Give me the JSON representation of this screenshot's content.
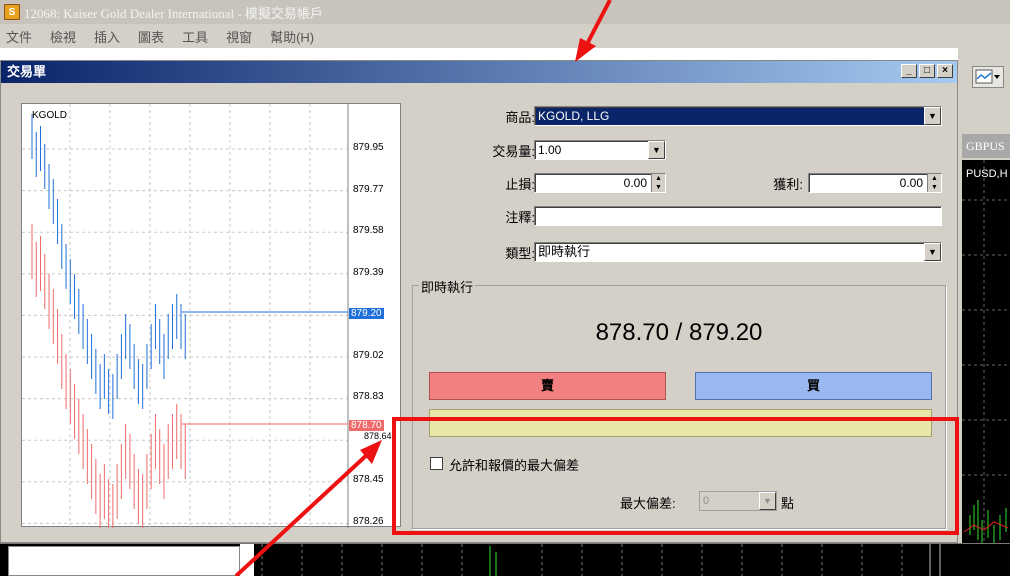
{
  "app": {
    "title": "12068: Kaiser Gold Dealer International - 模擬交易帳戶",
    "icon": "mt4-logo-icon"
  },
  "menu": [
    "文件",
    "檢視",
    "插入",
    "圖表",
    "工具",
    "視窗",
    "幫助(H)"
  ],
  "side": {
    "tab_label": "GBPUS",
    "chart_label": "PUSD,H"
  },
  "dialog": {
    "title": "交易單",
    "window_buttons": [
      "_",
      "□",
      "×"
    ],
    "chart": {
      "symbol": "KGOLD",
      "price_ticks": [
        "879.95",
        "879.77",
        "879.58",
        "879.39",
        "879.02",
        "878.83",
        "878.45",
        "878.26"
      ],
      "ask_tag": "879.20",
      "bid_tag": "878.70",
      "bid_tag_partial": "878.64"
    },
    "form": {
      "symbol_label": "商品:",
      "symbol_value": "KGOLD, LLG",
      "volume_label": "交易量:",
      "volume_value": "1.00",
      "stoploss_label": "止損:",
      "stoploss_value": "0.00",
      "takeprofit_label": "獲利:",
      "takeprofit_value": "0.00",
      "comment_label": "注釋:",
      "comment_value": "",
      "type_label": "類型:",
      "type_value": "即時執行"
    },
    "instant": {
      "group_title": "即時執行",
      "quote": "878.70 / 879.20",
      "sell_label": "賣",
      "buy_label": "買",
      "allow_deviation_label": "允許和報價的最大偏差",
      "max_deviation_label": "最大偏差:",
      "max_deviation_value": "0",
      "max_deviation_unit": "點"
    }
  },
  "colors": {
    "sell": "#f28080",
    "buy": "#9ab8f0",
    "ask_line": "#1e6fd9",
    "bid_line": "#ef6a6a",
    "annotation": "#ee1111"
  }
}
